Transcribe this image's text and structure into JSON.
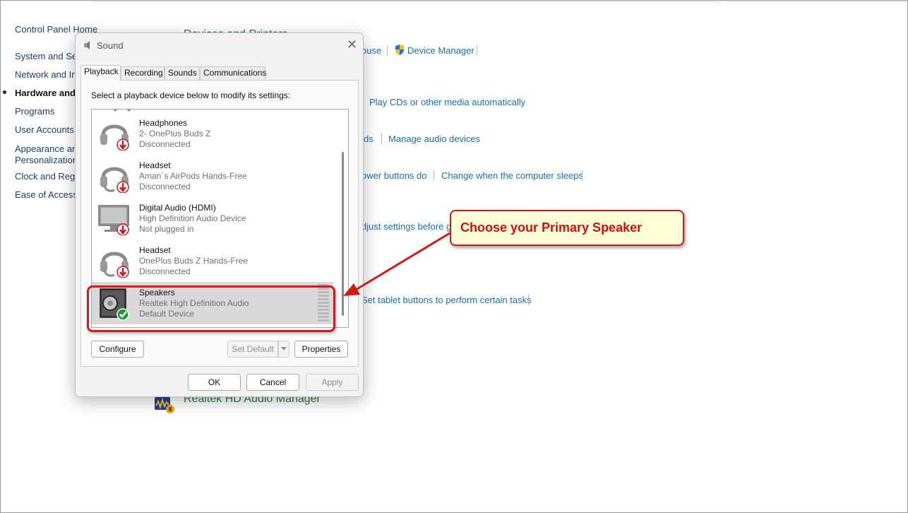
{
  "nav": {
    "items": [
      {
        "label": "Control Panel Home",
        "active": false
      },
      {
        "label": "System and Sec",
        "active": false
      },
      {
        "label": "Network and Int",
        "active": false
      },
      {
        "label": "Hardware and S",
        "active": true
      },
      {
        "label": "Programs",
        "active": false
      },
      {
        "label": "User Accounts",
        "active": false
      },
      {
        "label": "Appearance and",
        "active": false
      },
      {
        "label": "Personalization",
        "active": false
      },
      {
        "label": "Clock and Regio",
        "active": false
      },
      {
        "label": "Ease of Access",
        "active": false
      }
    ]
  },
  "main": {
    "devices_heading": "Devices and Printers",
    "realtek_heading": "Realtek HD Audio Manager",
    "links": {
      "mouse": "ouse",
      "device_manager": "Device Manager",
      "play_cds": "Play CDs or other media automatically",
      "sounds_fragment": "ds",
      "manage_audio": "Manage audio devices",
      "power_buttons": "ower buttons do",
      "sleep": "Change when the computer sleeps",
      "adjust": "djust settings before giv",
      "tablet": "Set tablet buttons to perform certain tasks"
    }
  },
  "dialog": {
    "title": "Sound",
    "close_glyph": "✕",
    "tabs": [
      "Playback",
      "Recording",
      "Sounds",
      "Communications"
    ],
    "active_tab": "Playback",
    "instruction": "Select a playback device below to modify its settings:",
    "devices": [
      {
        "name": "Headphones",
        "sub": "2- OnePlus Buds Z",
        "status": "Disconnected",
        "icon": "headphones-icon",
        "badge": "red-down-arrow"
      },
      {
        "name": "Headset",
        "sub": "Aman´s AirPods Hands-Free",
        "status": "Disconnected",
        "icon": "headset-icon",
        "badge": "red-down-arrow"
      },
      {
        "name": "Digital Audio (HDMI)",
        "sub": "High Definition Audio Device",
        "status": "Not plugged in",
        "icon": "monitor-icon",
        "badge": "red-down-arrow"
      },
      {
        "name": "Headset",
        "sub": "OnePlus Buds Z Hands-Free",
        "status": "Disconnected",
        "icon": "headset-icon",
        "badge": "red-down-arrow"
      },
      {
        "name": "Speakers",
        "sub": "Realtek High Definition Audio",
        "status": "Default Device",
        "icon": "speaker-icon",
        "badge": "green-check",
        "selected": true
      }
    ],
    "buttons": {
      "configure": "Configure",
      "set_default": "Set Default",
      "properties": "Properties",
      "ok": "OK",
      "cancel": "Cancel",
      "apply": "Apply"
    }
  },
  "annotation": {
    "callout_text": "Choose your Primary Speaker"
  },
  "colors": {
    "annotation_red": "#d11a1a",
    "callout_fill": "#fffdd8",
    "link_blue": "#1a6fb3",
    "heading_green": "#2a7a3a"
  }
}
